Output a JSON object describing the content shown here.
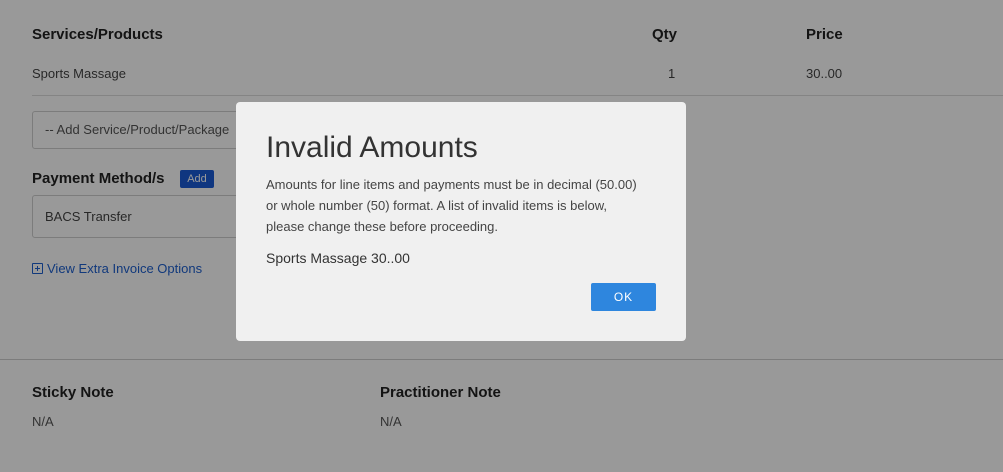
{
  "table": {
    "headers": {
      "service": "Services/Products",
      "qty": "Qty",
      "price": "Price"
    },
    "rows": [
      {
        "service": "Sports Massage",
        "qty": "1",
        "price": "30..00"
      }
    ]
  },
  "add_item": {
    "placeholder": "-- Add Service/Product/Package"
  },
  "payment": {
    "label": "Payment Method/s",
    "add_label": "Add",
    "method": "BACS Transfer"
  },
  "extra_options": {
    "label": "View Extra Invoice Options"
  },
  "notes": {
    "sticky_label": "Sticky Note",
    "sticky_value": "N/A",
    "practitioner_label": "Practitioner Note",
    "practitioner_value": "N/A"
  },
  "modal": {
    "title": "Invalid Amounts",
    "body": "Amounts for line items and payments must be in decimal (50.00) or whole number (50) format. A list of invalid items is below, please change these before proceeding.",
    "invalid_item": "Sports Massage 30..00",
    "ok_label": "OK"
  },
  "colors": {
    "accent": "#2e86de",
    "link": "#1d5fcf",
    "add_badge": "#1a5bd6",
    "overlay": "rgba(0,0,0,0.4)"
  }
}
